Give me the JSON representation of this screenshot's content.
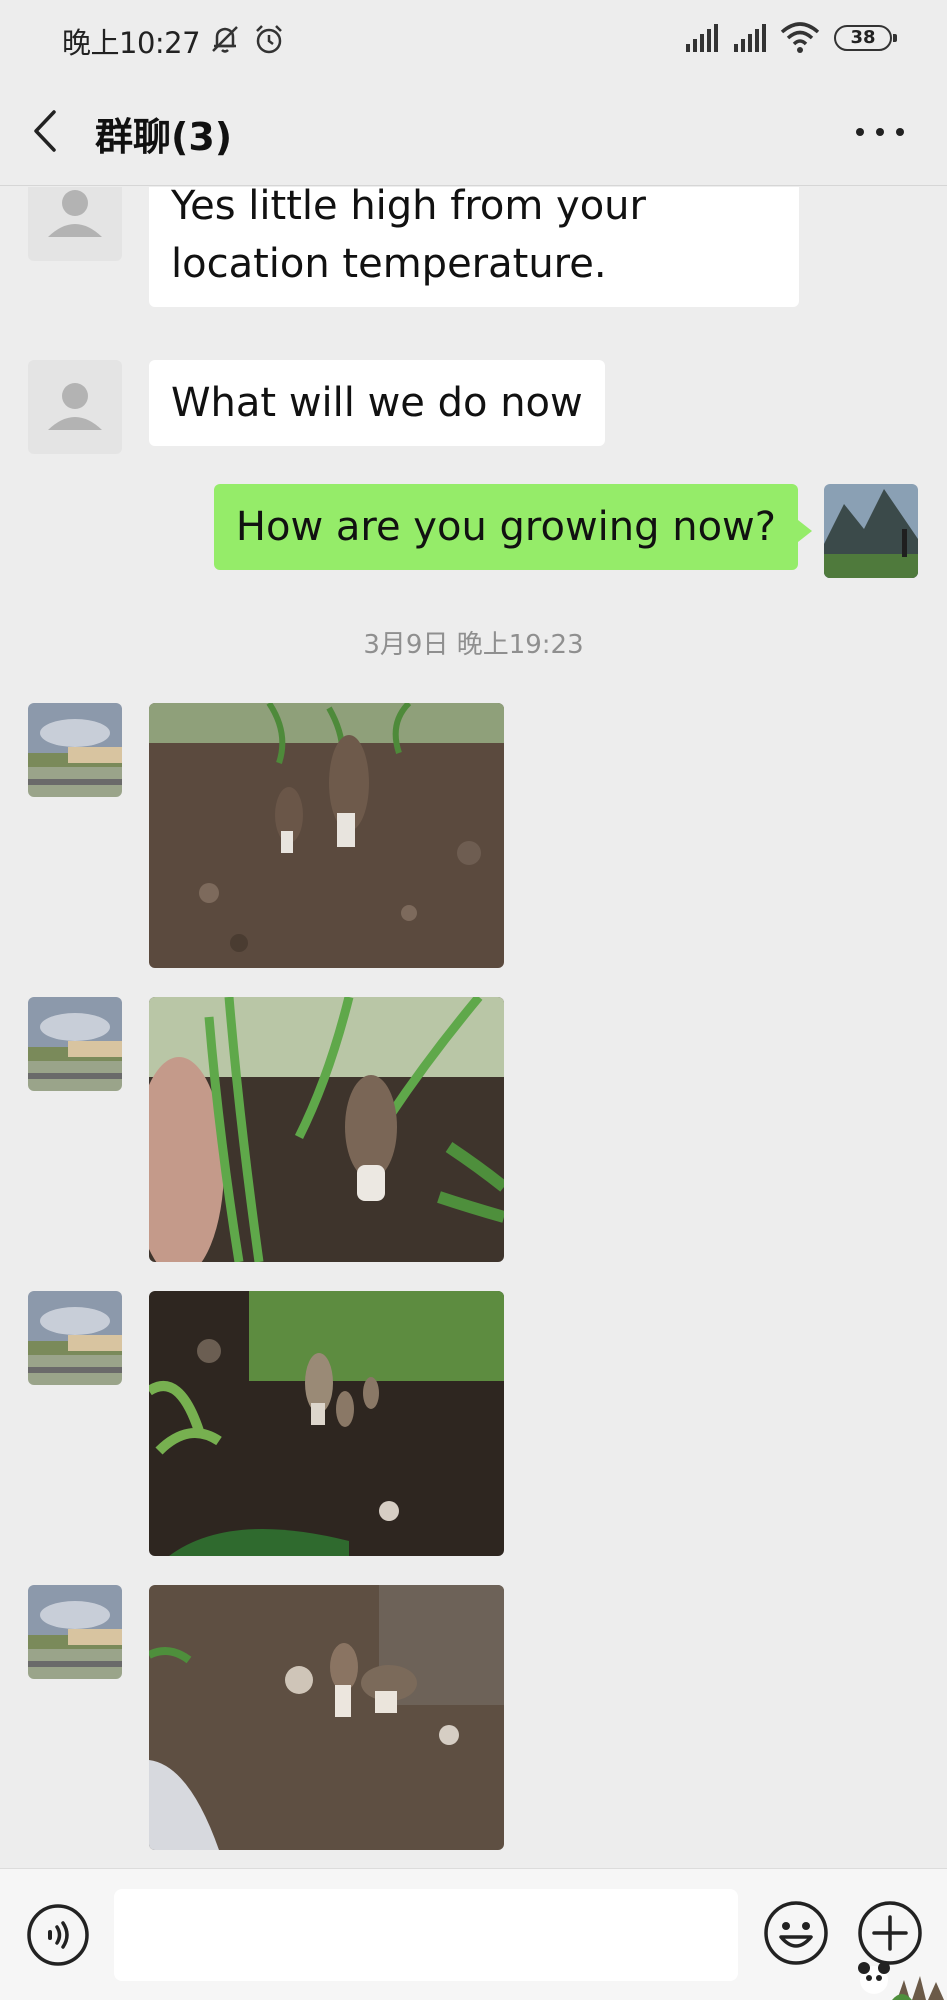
{
  "status_bar": {
    "time": "晚上10:27",
    "battery": "38",
    "icons": [
      "mute-notification-icon",
      "alarm-icon",
      "signal-icon",
      "signal-icon",
      "wifi-icon",
      "battery-icon"
    ]
  },
  "header": {
    "title": "群聊(3)",
    "back_icon": "chevron-left-icon",
    "more_icon": "ellipsis-icon"
  },
  "messages": [
    {
      "side": "incoming",
      "avatar": "default-avatar",
      "text": "Yes little high from your location temperature."
    },
    {
      "side": "incoming",
      "avatar": "default-avatar",
      "text": "What will we do now"
    },
    {
      "side": "outgoing",
      "avatar": "landscape-avatar",
      "text": "How are you growing now?"
    }
  ],
  "timestamp": "3月9日 晚上19:23",
  "photos": [
    {
      "side": "incoming",
      "subject": "morel mushrooms in soil"
    },
    {
      "side": "incoming",
      "subject": "morel mushroom with grass"
    },
    {
      "side": "incoming",
      "subject": "small morels in soil"
    },
    {
      "side": "incoming",
      "subject": "morels near plastic"
    }
  ],
  "input_bar": {
    "value": "",
    "placeholder": "",
    "icons": [
      "voice-icon",
      "emoji-icon",
      "plus-icon"
    ]
  },
  "colors": {
    "background": "#ededed",
    "outgoing_bubble": "#95ec69",
    "incoming_bubble": "#ffffff",
    "timestamp": "#8f8f8f"
  }
}
